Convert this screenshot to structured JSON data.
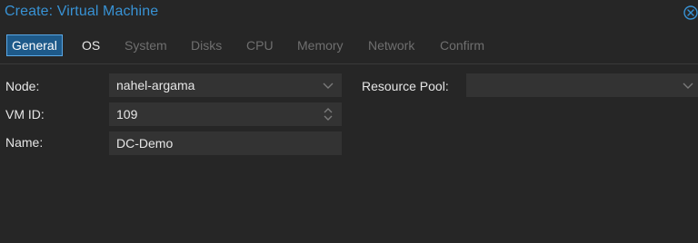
{
  "dialog": {
    "title": "Create: Virtual Machine"
  },
  "tabs": [
    {
      "label": "General",
      "state": "active"
    },
    {
      "label": "OS",
      "state": "enabled"
    },
    {
      "label": "System",
      "state": "disabled"
    },
    {
      "label": "Disks",
      "state": "disabled"
    },
    {
      "label": "CPU",
      "state": "disabled"
    },
    {
      "label": "Memory",
      "state": "disabled"
    },
    {
      "label": "Network",
      "state": "disabled"
    },
    {
      "label": "Confirm",
      "state": "disabled"
    }
  ],
  "form": {
    "node": {
      "label": "Node:",
      "value": "nahel-argama"
    },
    "vm_id": {
      "label": "VM ID:",
      "value": "109"
    },
    "name": {
      "label": "Name:",
      "value": "DC-Demo"
    },
    "resource_pool": {
      "label": "Resource Pool:",
      "value": ""
    }
  },
  "colors": {
    "accent": "#3892d4",
    "background": "#262626",
    "field": "#333333"
  },
  "icons": {
    "close": "close-circle-icon",
    "dropdown": "chevron-down-icon",
    "spinner": "spinner-updown-icon"
  }
}
